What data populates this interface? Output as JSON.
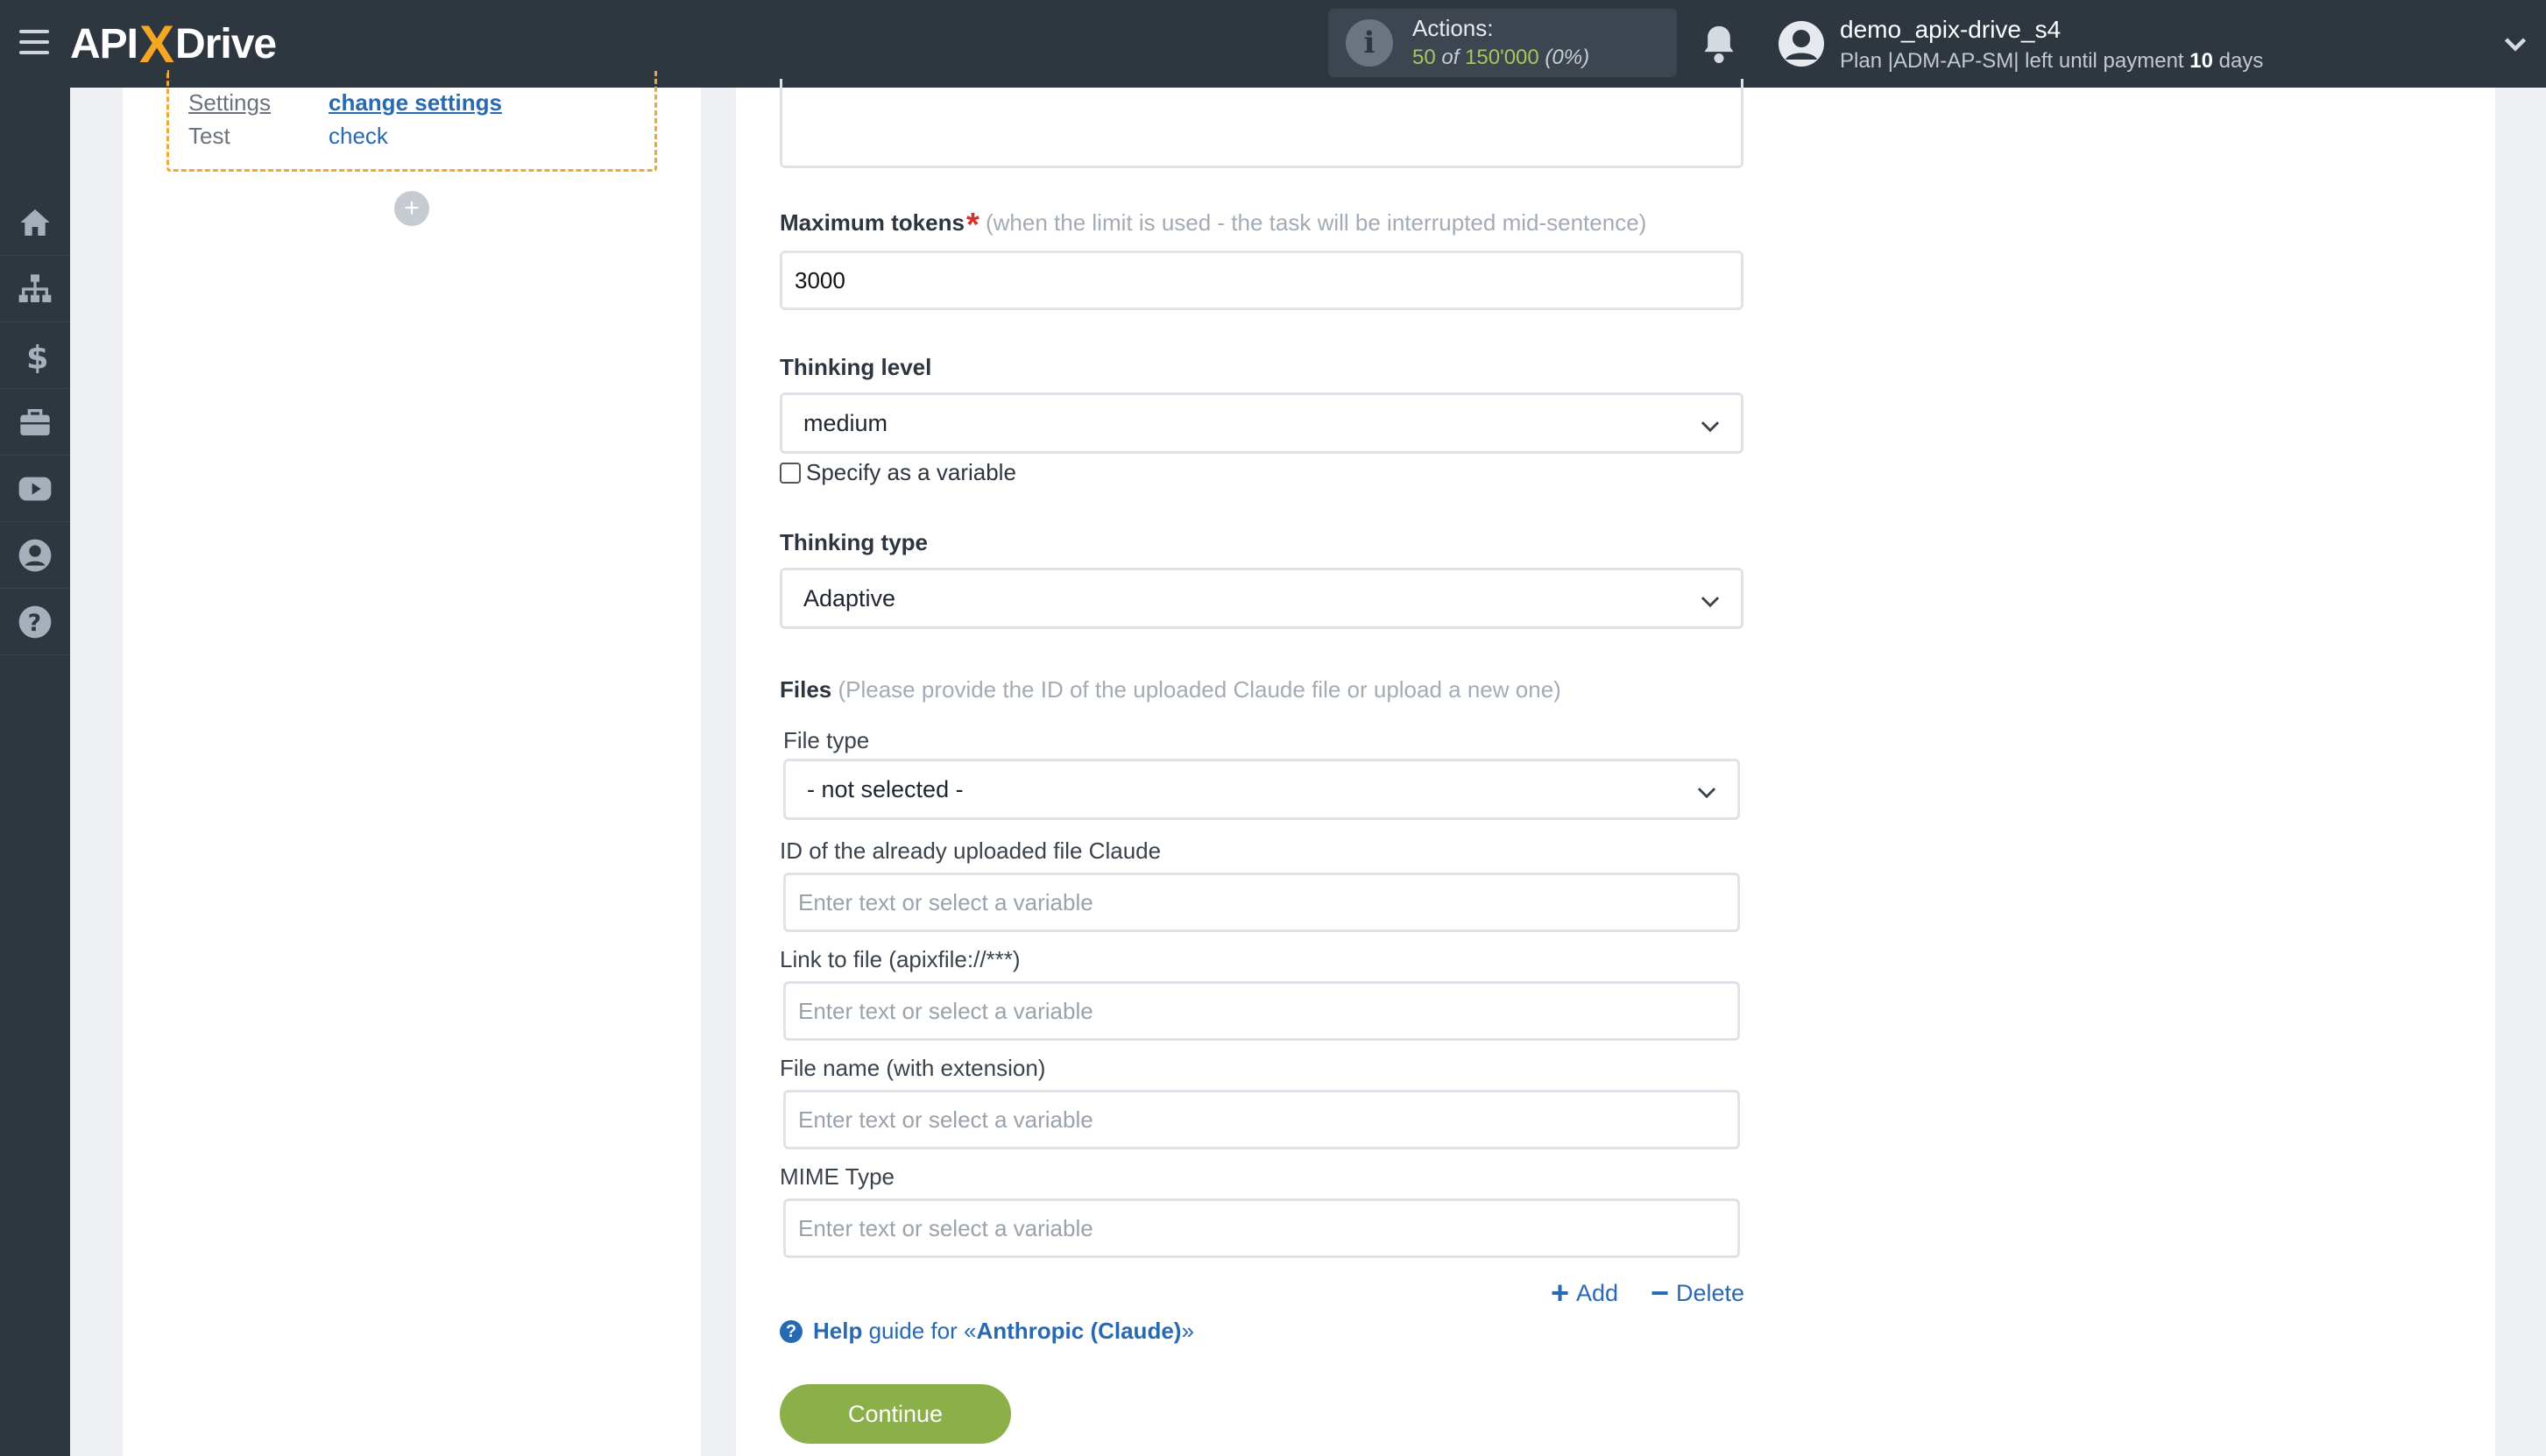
{
  "header": {
    "logo": {
      "left": "API",
      "x": "X",
      "right": "Drive"
    },
    "actions": {
      "label": "Actions:",
      "used": "50",
      "of": "of",
      "total": "150'000",
      "percent": "(0%)"
    },
    "user": {
      "name": "demo_apix-drive_s4",
      "plan_prefix": "Plan |ADM-AP-SM| left until payment",
      "days": "10",
      "days_suffix": "days"
    }
  },
  "nav": {
    "items": [
      "home-icon",
      "sitemap-icon",
      "dollar-icon",
      "briefcase-icon",
      "youtube-icon",
      "user-circle-icon",
      "help-circle-icon"
    ]
  },
  "steps": {
    "rows": [
      {
        "key": "Settings",
        "value": "change settings"
      },
      {
        "key": "Test",
        "value": "check"
      }
    ],
    "add": "+"
  },
  "form": {
    "max_tokens": {
      "label": "Maximum tokens",
      "required": "*",
      "hint": "(when the limit is used - the task will be interrupted mid-sentence)",
      "value": "3000"
    },
    "thinking_level": {
      "label": "Thinking level",
      "value": "medium",
      "checkbox_label": "Specify as a variable"
    },
    "thinking_type": {
      "label": "Thinking type",
      "value": "Adaptive"
    },
    "files": {
      "label": "Files",
      "hint": "(Please provide the ID of the uploaded Claude file or upload a new one)",
      "file_type_label": "File type",
      "file_type_value": "- not selected -",
      "id_label": "ID of the already uploaded file Claude",
      "link_label": "Link to file (apixfile://***)",
      "name_label": "File name (with extension)",
      "mime_label": "MIME Type",
      "placeholder": "Enter text or select a variable",
      "add_label": "Add",
      "delete_label": "Delete"
    },
    "help": {
      "strong": "Help",
      "mid": "guide for «",
      "service": "Anthropic (Claude)",
      "end": "»"
    },
    "continue_label": "Continue"
  },
  "colors": {
    "topbar": "#2e3640",
    "accent_link": "#2869b3",
    "continue": "#8bb049",
    "dashed_border": "#f0a733",
    "counts_green": "#a9c45d"
  }
}
